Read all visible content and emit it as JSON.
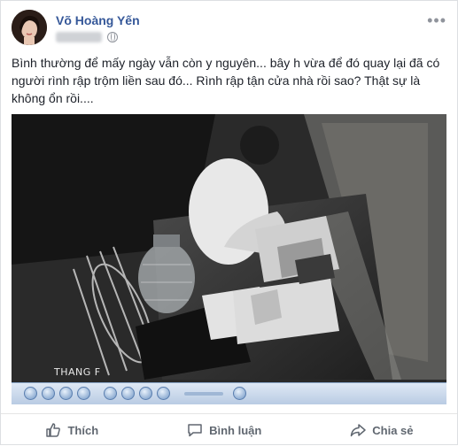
{
  "post": {
    "author": "Võ Hoàng Yến",
    "more_icon": "ellipsis-icon",
    "privacy_icon": "globe-icon",
    "text": "Bình thường để mấy ngày vẫn còn y nguyên... bây h vừa để đó quay lại đã có người rình rập trộm liền sau đó... Rình rập tận cửa nhà rồi sao? Thật sự là không ổn rồi...."
  },
  "video": {
    "stamp": "THANG F"
  },
  "actions": {
    "like": "Thích",
    "comment": "Bình luận",
    "share": "Chia sẻ"
  }
}
